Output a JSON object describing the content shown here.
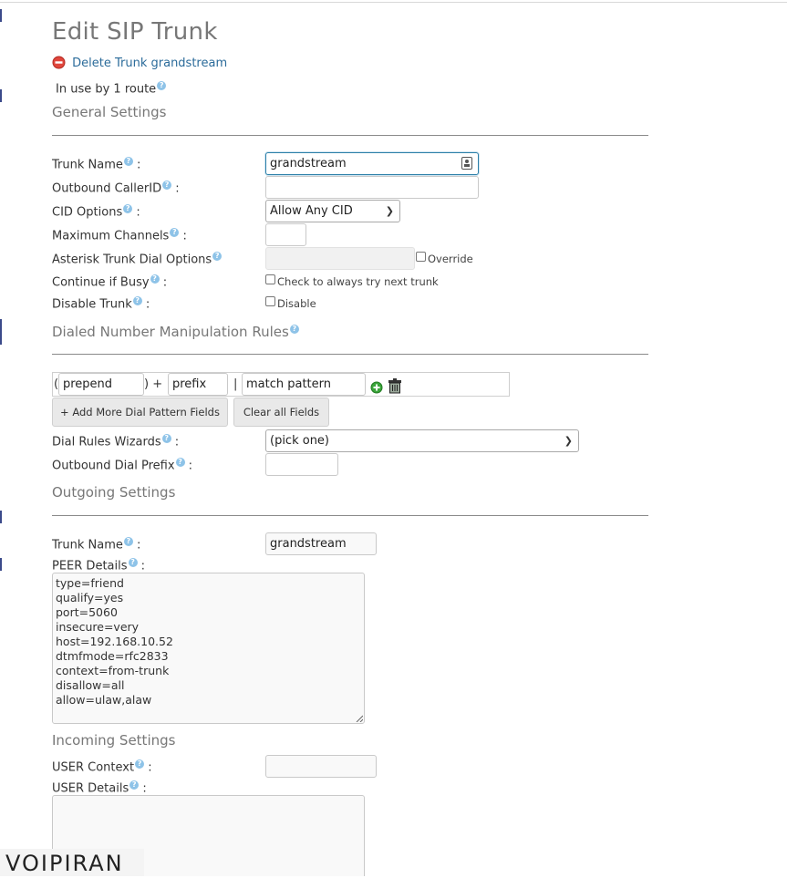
{
  "page": {
    "title": "Edit SIP Trunk",
    "delete_link": "Delete Trunk grandstream",
    "in_use": "In use by 1 route"
  },
  "general": {
    "section_title": "General Settings",
    "trunk_name_label": "Trunk Name",
    "trunk_name_value": "grandstream",
    "outbound_callerid_label": "Outbound CallerID",
    "outbound_callerid_value": "",
    "cid_options_label": "CID Options",
    "cid_options_selected": "Allow Any CID",
    "max_channels_label": "Maximum Channels",
    "max_channels_value": "",
    "dial_options_label": "Asterisk Trunk Dial Options",
    "override_label": "Override",
    "continue_busy_label": "Continue if Busy",
    "continue_busy_option": "Check to always try next trunk",
    "disable_trunk_label": "Disable Trunk",
    "disable_option": "Disable",
    "colon": ":"
  },
  "dial_rules": {
    "section_title": "Dialed Number Manipulation Rules",
    "open_paren": "(",
    "close_plus": ") +",
    "pipe": "|",
    "prepend_placeholder": "prepend",
    "prefix_placeholder": "prefix",
    "match_placeholder": "match pattern",
    "add_more_button": "+ Add More Dial Pattern Fields",
    "clear_button": "Clear all Fields",
    "wizards_label": "Dial Rules Wizards",
    "wizards_selected": "(pick one)",
    "outbound_prefix_label": "Outbound Dial Prefix",
    "outbound_prefix_value": ""
  },
  "outgoing": {
    "section_title": "Outgoing Settings",
    "trunk_name_label": "Trunk Name",
    "trunk_name_value": "grandstream",
    "peer_details_label": "PEER Details",
    "peer_details_lines": [
      "type=friend",
      "qualify=yes",
      "port=5060",
      "insecure=very",
      "host=192.168.10.52",
      "dtmfmode=rfc2833",
      "context=from-trunk",
      "disallow=all",
      "allow=ulaw,alaw"
    ]
  },
  "incoming": {
    "section_title": "Incoming Settings",
    "user_context_label": "USER Context",
    "user_context_value": "",
    "user_details_label": "USER Details"
  },
  "watermark": {
    "text": "VOIPIRAN"
  },
  "colors": {
    "accent": "#2c7fa8",
    "link": "#2b6b9a",
    "help": "#8ec3e8",
    "delete": "#e0463c",
    "add": "#3aa53a"
  }
}
